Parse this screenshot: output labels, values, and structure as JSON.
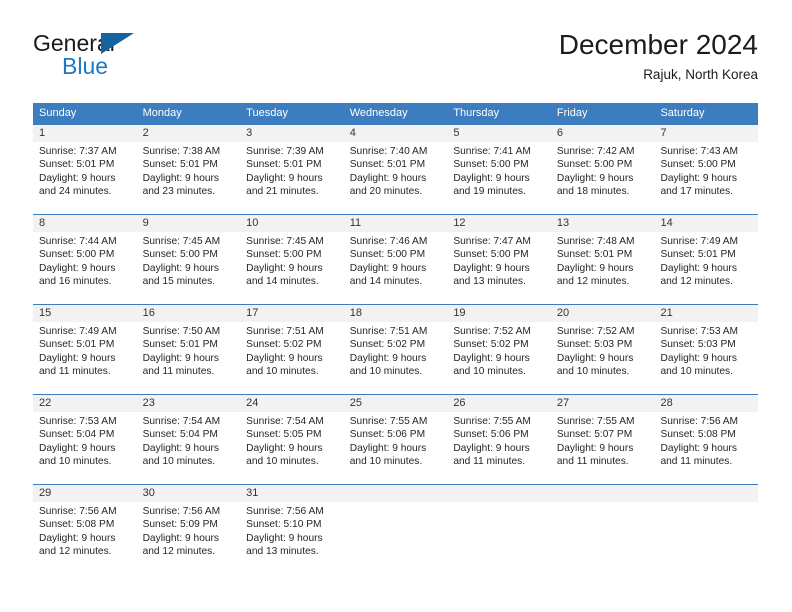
{
  "brand": {
    "name_part1": "General",
    "name_part2": "Blue",
    "color_dark": "#1a1a1a",
    "color_blue": "#1f78c1",
    "triangle_color": "#1464a0"
  },
  "header": {
    "title": "December 2024",
    "subtitle": "Rajuk, North Korea"
  },
  "theme": {
    "header_blue": "#3b7dbe",
    "daynum_band": "#f2f2f2",
    "text": "#262626"
  },
  "weekday_headers": [
    "Sunday",
    "Monday",
    "Tuesday",
    "Wednesday",
    "Thursday",
    "Friday",
    "Saturday"
  ],
  "weeks": [
    [
      {
        "day": "1",
        "l1": "Sunrise: 7:37 AM",
        "l2": "Sunset: 5:01 PM",
        "l3": "Daylight: 9 hours",
        "l4": "and 24 minutes."
      },
      {
        "day": "2",
        "l1": "Sunrise: 7:38 AM",
        "l2": "Sunset: 5:01 PM",
        "l3": "Daylight: 9 hours",
        "l4": "and 23 minutes."
      },
      {
        "day": "3",
        "l1": "Sunrise: 7:39 AM",
        "l2": "Sunset: 5:01 PM",
        "l3": "Daylight: 9 hours",
        "l4": "and 21 minutes."
      },
      {
        "day": "4",
        "l1": "Sunrise: 7:40 AM",
        "l2": "Sunset: 5:01 PM",
        "l3": "Daylight: 9 hours",
        "l4": "and 20 minutes."
      },
      {
        "day": "5",
        "l1": "Sunrise: 7:41 AM",
        "l2": "Sunset: 5:00 PM",
        "l3": "Daylight: 9 hours",
        "l4": "and 19 minutes."
      },
      {
        "day": "6",
        "l1": "Sunrise: 7:42 AM",
        "l2": "Sunset: 5:00 PM",
        "l3": "Daylight: 9 hours",
        "l4": "and 18 minutes."
      },
      {
        "day": "7",
        "l1": "Sunrise: 7:43 AM",
        "l2": "Sunset: 5:00 PM",
        "l3": "Daylight: 9 hours",
        "l4": "and 17 minutes."
      }
    ],
    [
      {
        "day": "8",
        "l1": "Sunrise: 7:44 AM",
        "l2": "Sunset: 5:00 PM",
        "l3": "Daylight: 9 hours",
        "l4": "and 16 minutes."
      },
      {
        "day": "9",
        "l1": "Sunrise: 7:45 AM",
        "l2": "Sunset: 5:00 PM",
        "l3": "Daylight: 9 hours",
        "l4": "and 15 minutes."
      },
      {
        "day": "10",
        "l1": "Sunrise: 7:45 AM",
        "l2": "Sunset: 5:00 PM",
        "l3": "Daylight: 9 hours",
        "l4": "and 14 minutes."
      },
      {
        "day": "11",
        "l1": "Sunrise: 7:46 AM",
        "l2": "Sunset: 5:00 PM",
        "l3": "Daylight: 9 hours",
        "l4": "and 14 minutes."
      },
      {
        "day": "12",
        "l1": "Sunrise: 7:47 AM",
        "l2": "Sunset: 5:00 PM",
        "l3": "Daylight: 9 hours",
        "l4": "and 13 minutes."
      },
      {
        "day": "13",
        "l1": "Sunrise: 7:48 AM",
        "l2": "Sunset: 5:01 PM",
        "l3": "Daylight: 9 hours",
        "l4": "and 12 minutes."
      },
      {
        "day": "14",
        "l1": "Sunrise: 7:49 AM",
        "l2": "Sunset: 5:01 PM",
        "l3": "Daylight: 9 hours",
        "l4": "and 12 minutes."
      }
    ],
    [
      {
        "day": "15",
        "l1": "Sunrise: 7:49 AM",
        "l2": "Sunset: 5:01 PM",
        "l3": "Daylight: 9 hours",
        "l4": "and 11 minutes."
      },
      {
        "day": "16",
        "l1": "Sunrise: 7:50 AM",
        "l2": "Sunset: 5:01 PM",
        "l3": "Daylight: 9 hours",
        "l4": "and 11 minutes."
      },
      {
        "day": "17",
        "l1": "Sunrise: 7:51 AM",
        "l2": "Sunset: 5:02 PM",
        "l3": "Daylight: 9 hours",
        "l4": "and 10 minutes."
      },
      {
        "day": "18",
        "l1": "Sunrise: 7:51 AM",
        "l2": "Sunset: 5:02 PM",
        "l3": "Daylight: 9 hours",
        "l4": "and 10 minutes."
      },
      {
        "day": "19",
        "l1": "Sunrise: 7:52 AM",
        "l2": "Sunset: 5:02 PM",
        "l3": "Daylight: 9 hours",
        "l4": "and 10 minutes."
      },
      {
        "day": "20",
        "l1": "Sunrise: 7:52 AM",
        "l2": "Sunset: 5:03 PM",
        "l3": "Daylight: 9 hours",
        "l4": "and 10 minutes."
      },
      {
        "day": "21",
        "l1": "Sunrise: 7:53 AM",
        "l2": "Sunset: 5:03 PM",
        "l3": "Daylight: 9 hours",
        "l4": "and 10 minutes."
      }
    ],
    [
      {
        "day": "22",
        "l1": "Sunrise: 7:53 AM",
        "l2": "Sunset: 5:04 PM",
        "l3": "Daylight: 9 hours",
        "l4": "and 10 minutes."
      },
      {
        "day": "23",
        "l1": "Sunrise: 7:54 AM",
        "l2": "Sunset: 5:04 PM",
        "l3": "Daylight: 9 hours",
        "l4": "and 10 minutes."
      },
      {
        "day": "24",
        "l1": "Sunrise: 7:54 AM",
        "l2": "Sunset: 5:05 PM",
        "l3": "Daylight: 9 hours",
        "l4": "and 10 minutes."
      },
      {
        "day": "25",
        "l1": "Sunrise: 7:55 AM",
        "l2": "Sunset: 5:06 PM",
        "l3": "Daylight: 9 hours",
        "l4": "and 10 minutes."
      },
      {
        "day": "26",
        "l1": "Sunrise: 7:55 AM",
        "l2": "Sunset: 5:06 PM",
        "l3": "Daylight: 9 hours",
        "l4": "and 11 minutes."
      },
      {
        "day": "27",
        "l1": "Sunrise: 7:55 AM",
        "l2": "Sunset: 5:07 PM",
        "l3": "Daylight: 9 hours",
        "l4": "and 11 minutes."
      },
      {
        "day": "28",
        "l1": "Sunrise: 7:56 AM",
        "l2": "Sunset: 5:08 PM",
        "l3": "Daylight: 9 hours",
        "l4": "and 11 minutes."
      }
    ],
    [
      {
        "day": "29",
        "l1": "Sunrise: 7:56 AM",
        "l2": "Sunset: 5:08 PM",
        "l3": "Daylight: 9 hours",
        "l4": "and 12 minutes."
      },
      {
        "day": "30",
        "l1": "Sunrise: 7:56 AM",
        "l2": "Sunset: 5:09 PM",
        "l3": "Daylight: 9 hours",
        "l4": "and 12 minutes."
      },
      {
        "day": "31",
        "l1": "Sunrise: 7:56 AM",
        "l2": "Sunset: 5:10 PM",
        "l3": "Daylight: 9 hours",
        "l4": "and 13 minutes."
      },
      {
        "day": "",
        "l1": "",
        "l2": "",
        "l3": "",
        "l4": ""
      },
      {
        "day": "",
        "l1": "",
        "l2": "",
        "l3": "",
        "l4": ""
      },
      {
        "day": "",
        "l1": "",
        "l2": "",
        "l3": "",
        "l4": ""
      },
      {
        "day": "",
        "l1": "",
        "l2": "",
        "l3": "",
        "l4": ""
      }
    ]
  ]
}
